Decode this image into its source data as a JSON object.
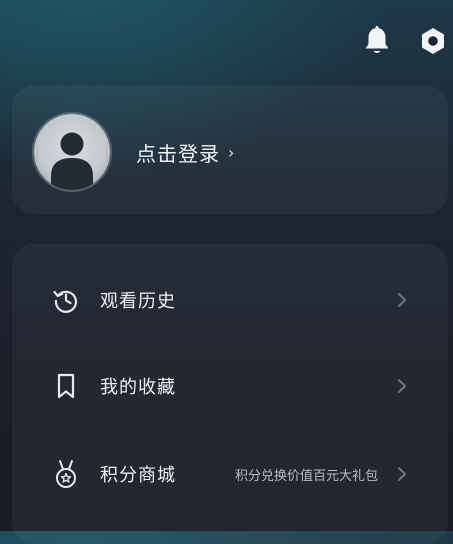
{
  "topbar": {
    "icons": [
      "bell-icon",
      "gear-icon"
    ]
  },
  "profile": {
    "login_label": "点击登录",
    "chevron": "›"
  },
  "menu": {
    "items": [
      {
        "label": "观看历史",
        "icon": "history-icon",
        "sub": ""
      },
      {
        "label": "我的收藏",
        "icon": "bookmark-icon",
        "sub": ""
      },
      {
        "label": "积分商城",
        "icon": "medal-icon",
        "sub": "积分兑换价值百元大礼包"
      }
    ]
  },
  "colors": {
    "bg_top": "#1d3848",
    "bg_bottom": "#1a1c26",
    "text": "#eef1f3",
    "muted": "#b8bdc2"
  }
}
